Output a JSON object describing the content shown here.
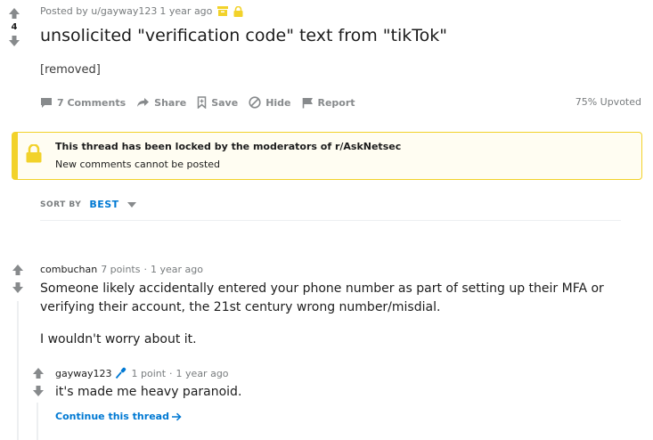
{
  "post": {
    "score": "4",
    "posted_by": "Posted by u/gayway123",
    "age": "1 year ago",
    "icons": [
      "archived-icon",
      "lock-icon"
    ],
    "title": "unsolicited \"verification code\" text from \"tikTok\"",
    "body": "[removed]",
    "actions": {
      "comments": "7 Comments",
      "share": "Share",
      "save": "Save",
      "hide": "Hide",
      "report": "Report"
    },
    "upvoted": "75% Upvoted"
  },
  "locked_banner": {
    "title": "This thread has been locked by the moderators of r/AskNetsec",
    "subtitle": "New comments cannot be posted",
    "color": "#f2d22a"
  },
  "sort": {
    "label": "SORT BY",
    "value": "BEST"
  },
  "comments": [
    {
      "author": "combuchan",
      "points": "7 points",
      "sep": "·",
      "age": "1 year ago",
      "paragraphs": [
        "Someone likely accidentally entered your phone number as part of setting up their MFA or verifying their account, the 21st century wrong number/misdial.",
        "I wouldn't worry about it."
      ]
    },
    {
      "author": "gayway123",
      "points": "1 point",
      "sep": "·",
      "age": "1 year ago",
      "text": "it's made me heavy paranoid.",
      "continue": "Continue this thread"
    }
  ],
  "colors": {
    "accent": "#0079d3",
    "muted": "#878a8c",
    "lock": "#f2d22a"
  }
}
